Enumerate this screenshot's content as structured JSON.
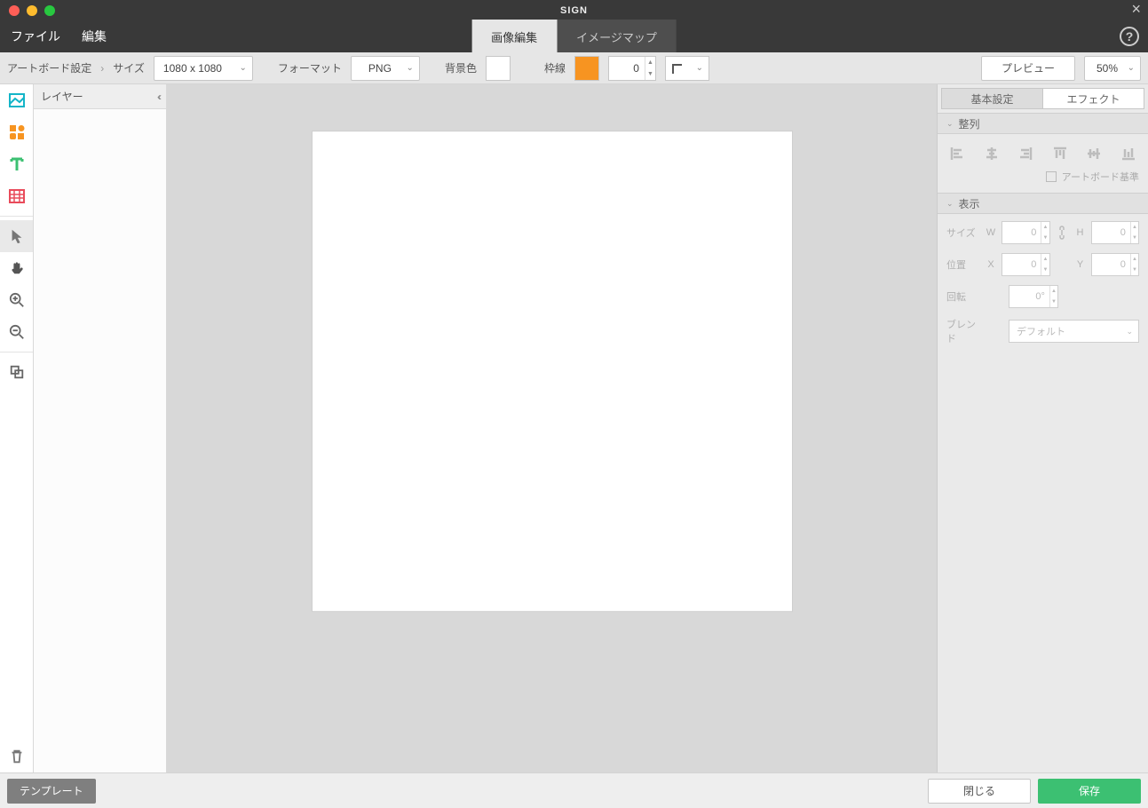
{
  "titlebar": {
    "title": "SIGN"
  },
  "menu": {
    "file": "ファイル",
    "edit": "編集"
  },
  "main_tabs": {
    "image_edit": "画像編集",
    "image_map": "イメージマップ"
  },
  "optbar": {
    "artboard_settings": "アートボード設定",
    "size_label": "サイズ",
    "size_value": "1080 x 1080",
    "format_label": "フォーマット",
    "format_value": "PNG",
    "bg_label": "背景色",
    "bg_color": "#ffffff",
    "border_label": "枠線",
    "border_color": "#f79421",
    "border_width": "0",
    "preview": "プレビュー",
    "zoom": "50%"
  },
  "layers": {
    "title": "レイヤー"
  },
  "inspector": {
    "tab_basic": "基本設定",
    "tab_effects": "エフェクト",
    "section_align": "整列",
    "artboard_ref": "アートボード基準",
    "section_display": "表示",
    "size_label": "サイズ",
    "w_label": "W",
    "w_value": "0",
    "h_label": "H",
    "h_value": "0",
    "pos_label": "位置",
    "x_label": "X",
    "x_value": "0",
    "y_label": "Y",
    "y_value": "0",
    "rot_label": "回転",
    "rot_value": "0°",
    "blend_label": "ブレンド",
    "blend_value": "デフォルト"
  },
  "footer": {
    "template": "テンプレート",
    "close": "閉じる",
    "save": "保存"
  }
}
